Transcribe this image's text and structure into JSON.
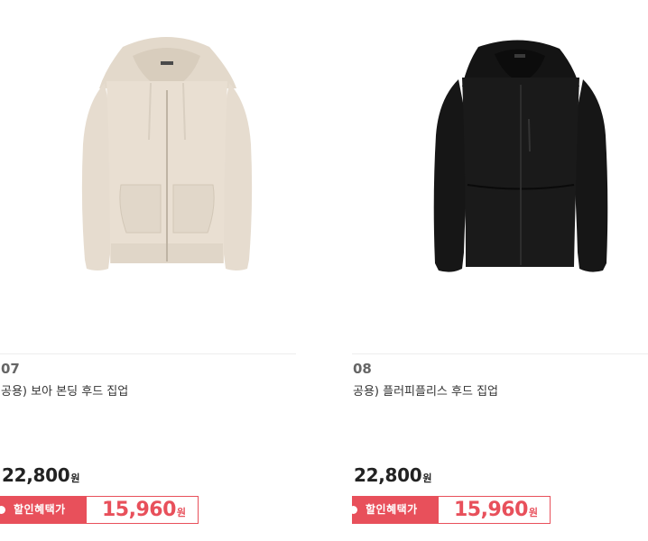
{
  "products": [
    {
      "number": "07",
      "name": "공용) 보아 본딩 후드 집업",
      "image_icon": "beige-hoodie-image",
      "price": "22,800",
      "price_unit": "원",
      "discount_label": "할인혜택가",
      "sale_price": "15,960",
      "sale_unit": "원"
    },
    {
      "number": "08",
      "name": "공용) 플러피플리스 후드 집업",
      "image_icon": "black-hoodie-image",
      "price": "22,800",
      "price_unit": "원",
      "discount_label": "할인혜택가",
      "sale_price": "15,960",
      "sale_unit": "원"
    }
  ],
  "colors": {
    "accent": "#e8505b",
    "price_text": "#222222",
    "number_text": "#666666",
    "beige_product": "#e6dccf",
    "black_product": "#141414"
  }
}
